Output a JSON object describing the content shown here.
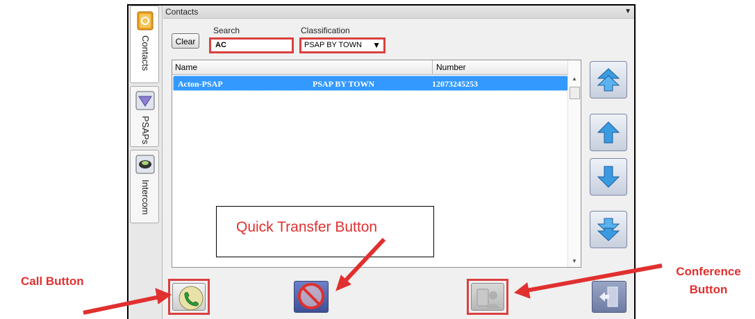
{
  "panel": {
    "title": "Contacts",
    "tabs": [
      {
        "label": "Contacts"
      },
      {
        "label": "PSAPs"
      },
      {
        "label": "Intercom"
      }
    ]
  },
  "search": {
    "clear_label": "Clear",
    "label": "Search",
    "value": "AC"
  },
  "classification": {
    "label": "Classification",
    "selected": "PSAP BY TOWN"
  },
  "table": {
    "columns": [
      "Name",
      "Number"
    ],
    "rows": [
      {
        "name": "Acton-PSAP",
        "classification": "PSAP BY TOWN",
        "number": "12073245253",
        "selected": true
      }
    ]
  },
  "annotations": {
    "quick_transfer": "Quick Transfer Button",
    "call": "Call Button",
    "conference_line1": "Conference",
    "conference_line2": "Button"
  },
  "colors": {
    "highlight": "#d9403f",
    "selection": "#3399ff",
    "annotation_text": "#e0302f"
  }
}
